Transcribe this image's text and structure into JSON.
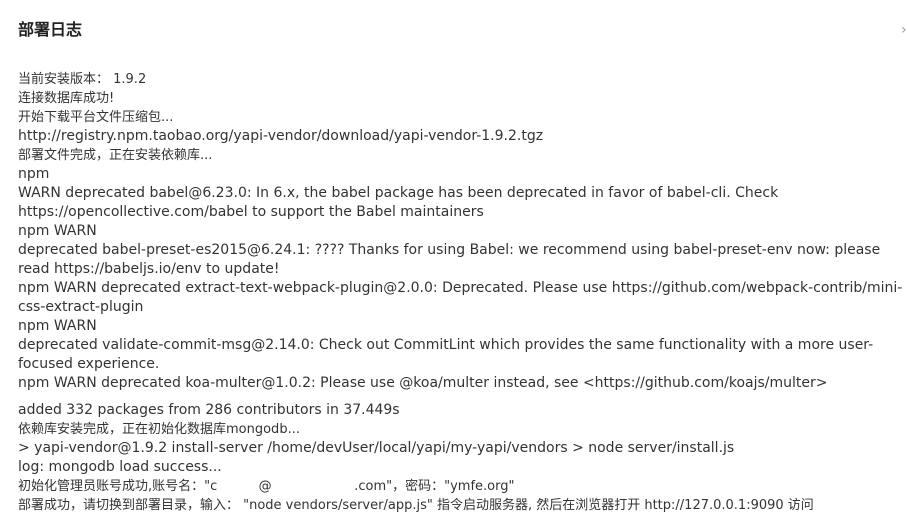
{
  "modal": {
    "title": "部署日志",
    "close_glyph": "›"
  },
  "log_lines": [
    "当前安装版本： 1.9.2",
    "连接数据库成功!",
    "开始下载平台文件压缩包...",
    "http://registry.npm.taobao.org/yapi-vendor/download/yapi-vendor-1.9.2.tgz",
    "部署文件完成，正在安装依赖库...",
    "npm",
    "WARN deprecated babel@6.23.0: In 6.x, the babel package has been deprecated in favor of babel-cli. Check https://opencollective.com/babel to support the Babel maintainers",
    "npm WARN",
    "deprecated babel-preset-es2015@6.24.1: ???? Thanks for using Babel: we recommend using babel-preset-env now: please read https://babeljs.io/env to update!",
    "npm WARN deprecated extract-text-webpack-plugin@2.0.0: Deprecated. Please use https://github.com/webpack-contrib/mini-css-extract-plugin",
    "npm WARN",
    "deprecated validate-commit-msg@2.14.0: Check out CommitLint which provides the same functionality with a more user-focused experience.",
    "npm WARN deprecated koa-multer@1.0.2: Please use @koa/multer instead, see <https://github.com/koajs/multer>",
    "added 332 packages from 286 contributors in 37.449s",
    "依赖库安装完成，正在初始化数据库mongodb...",
    "> yapi-vendor@1.9.2 install-server /home/devUser/local/yapi/my-yapi/vendors > node server/install.js",
    "log: mongodb load success...",
    "初始化管理员账号成功,账号名：\"c          @                    .com\"，密码：\"ymfe.org\"",
    "部署成功，请切换到部署目录，输入： \"node vendors/server/app.js\" 指令启动服务器, 然后在浏览器打开 http://127.0.0.1:9090 访问"
  ]
}
